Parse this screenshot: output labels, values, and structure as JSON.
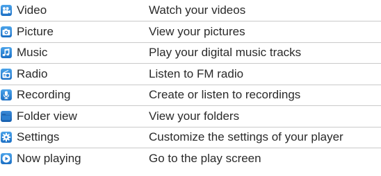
{
  "menu": {
    "items": [
      {
        "name": "Video",
        "description": "Watch your videos",
        "icon": "video-icon"
      },
      {
        "name": "Picture",
        "description": "View your pictures",
        "icon": "camera-icon"
      },
      {
        "name": "Music",
        "description": "Play your digital music tracks",
        "icon": "music-note-icon"
      },
      {
        "name": "Radio",
        "description": "Listen to FM radio",
        "icon": "radio-icon"
      },
      {
        "name": "Recording",
        "description": "Create or listen to recordings",
        "icon": "microphone-icon"
      },
      {
        "name": "Folder view",
        "description": "View your folders",
        "icon": "folder-icon"
      },
      {
        "name": "Settings",
        "description": "Customize the settings of your player",
        "icon": "gear-icon"
      },
      {
        "name": "Now playing",
        "description": "Go to the play screen",
        "icon": "play-icon"
      }
    ]
  },
  "colors": {
    "icon_blue": "#2a7fd4",
    "row_divider": "#c9c9c9",
    "text": "#2a2a2a"
  }
}
